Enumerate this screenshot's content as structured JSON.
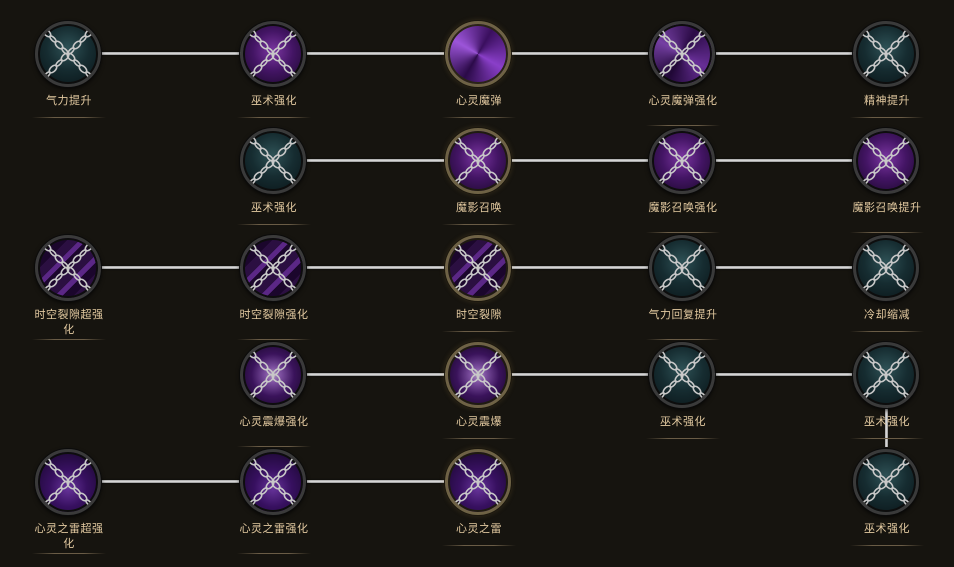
{
  "talent_tree": {
    "nodes": [
      {
        "id": "r1c1",
        "label": "气力提升",
        "row": 1,
        "col": 1,
        "icon": "teal-sparkle",
        "locked": true
      },
      {
        "id": "r1c2",
        "label": "巫术强化",
        "row": 1,
        "col": 2,
        "icon": "purple-orb",
        "locked": true
      },
      {
        "id": "r1c3",
        "label": "心灵魔弹",
        "row": 1,
        "col": 3,
        "icon": "purple-swirl",
        "locked": false
      },
      {
        "id": "r1c4",
        "label": "心灵魔弹强化",
        "row": 1,
        "col": 4,
        "icon": "purple-swirl",
        "locked": true
      },
      {
        "id": "r1c5",
        "label": "精神提升",
        "row": 1,
        "col": 5,
        "icon": "teal-sparkle",
        "locked": true
      },
      {
        "id": "r2c2",
        "label": "巫术强化",
        "row": 2,
        "col": 2,
        "icon": "teal-sparkle",
        "locked": true
      },
      {
        "id": "r2c3",
        "label": "魔影召唤",
        "row": 2,
        "col": 3,
        "icon": "purple-orb",
        "locked": true
      },
      {
        "id": "r2c4",
        "label": "魔影召唤强化",
        "row": 2,
        "col": 4,
        "icon": "purple-orb",
        "locked": true
      },
      {
        "id": "r2c5",
        "label": "魔影召唤提升",
        "row": 2,
        "col": 5,
        "icon": "purple-orb",
        "locked": true
      },
      {
        "id": "r3c1",
        "label": "时空裂隙超强化",
        "row": 3,
        "col": 1,
        "icon": "purple-rift",
        "locked": true
      },
      {
        "id": "r3c2",
        "label": "时空裂隙强化",
        "row": 3,
        "col": 2,
        "icon": "purple-rift",
        "locked": true
      },
      {
        "id": "r3c3",
        "label": "时空裂隙",
        "row": 3,
        "col": 3,
        "icon": "purple-rift",
        "locked": true
      },
      {
        "id": "r3c4",
        "label": "气力回复提升",
        "row": 3,
        "col": 4,
        "icon": "teal-sparkle",
        "locked": true
      },
      {
        "id": "r3c5",
        "label": "冷却缩减",
        "row": 3,
        "col": 5,
        "icon": "teal-sparkle",
        "locked": true
      },
      {
        "id": "r4c2",
        "label": "心灵震爆强化",
        "row": 4,
        "col": 2,
        "icon": "purple-burst",
        "locked": true
      },
      {
        "id": "r4c3",
        "label": "心灵震爆",
        "row": 4,
        "col": 3,
        "icon": "purple-burst",
        "locked": true
      },
      {
        "id": "r4c4",
        "label": "巫术强化",
        "row": 4,
        "col": 4,
        "icon": "teal-sparkle",
        "locked": true
      },
      {
        "id": "r4c5",
        "label": "巫术强化",
        "row": 4,
        "col": 5,
        "icon": "teal-sparkle",
        "locked": true
      },
      {
        "id": "r5c1",
        "label": "心灵之雷超强化",
        "row": 5,
        "col": 1,
        "icon": "purple-thunder",
        "locked": true
      },
      {
        "id": "r5c2",
        "label": "心灵之雷强化",
        "row": 5,
        "col": 2,
        "icon": "purple-thunder",
        "locked": true
      },
      {
        "id": "r5c3",
        "label": "心灵之雷",
        "row": 5,
        "col": 3,
        "icon": "purple-thunder",
        "locked": true
      },
      {
        "id": "r5c5",
        "label": "巫术强化",
        "row": 5,
        "col": 5,
        "icon": "teal-sparkle",
        "locked": true
      }
    ],
    "colors": {
      "background": "#16140f",
      "label_text": "#e2c9a0",
      "connector": "#d0d0d0",
      "chain": "#bdbdbd"
    }
  }
}
